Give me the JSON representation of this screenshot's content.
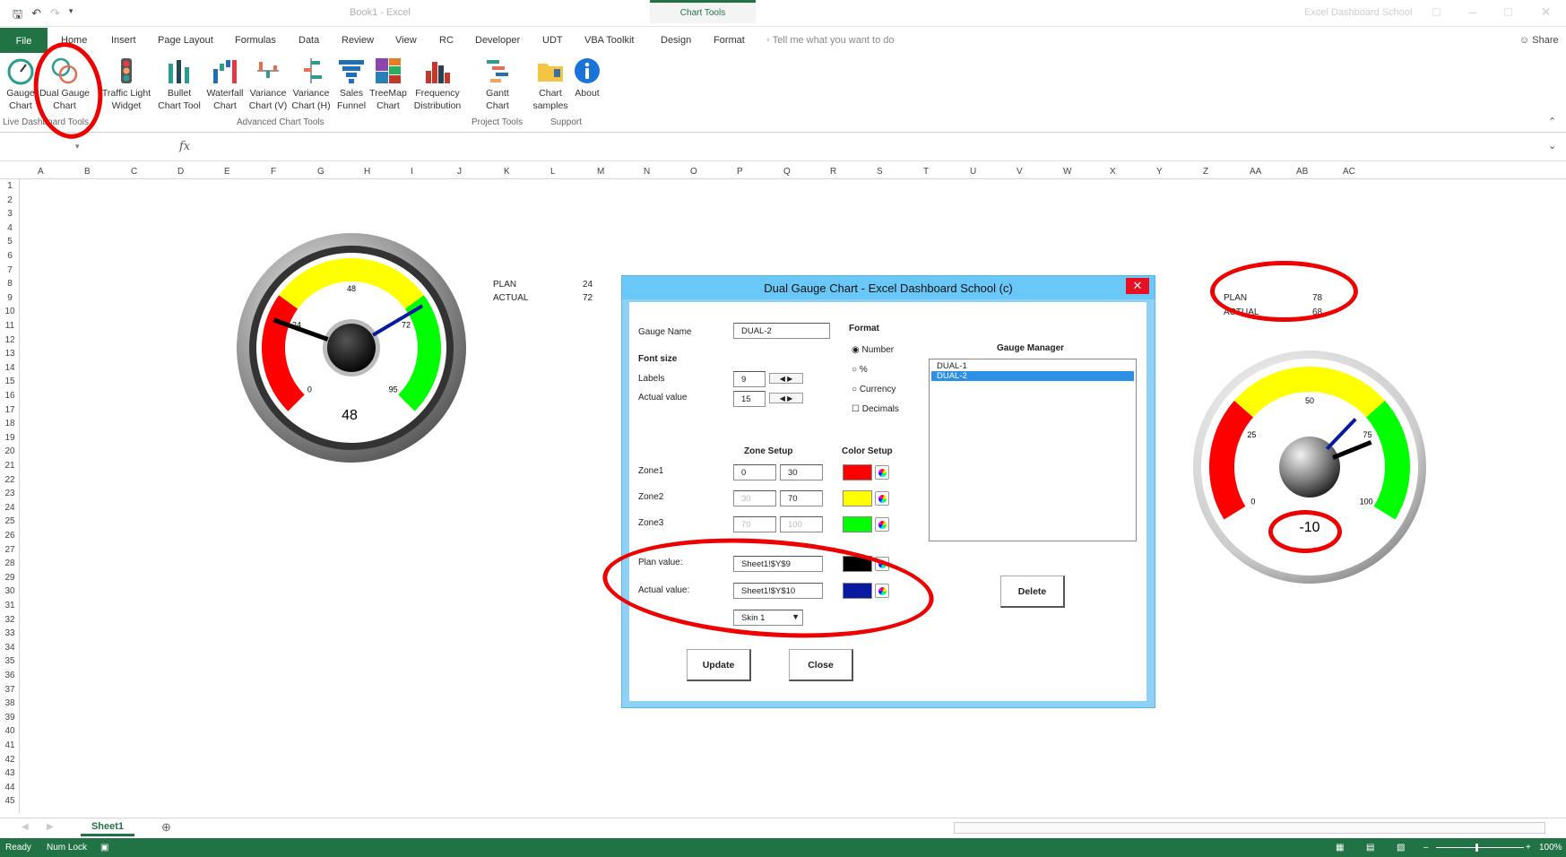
{
  "titlebar": {
    "doc_title": "Book1 - Excel",
    "chart_tools": "Chart Tools",
    "right_title": "Excel Dashboard School"
  },
  "tabs": [
    {
      "label": "File"
    },
    {
      "label": "Home"
    },
    {
      "label": "Insert"
    },
    {
      "label": "Page Layout"
    },
    {
      "label": "Formulas"
    },
    {
      "label": "Data"
    },
    {
      "label": "Review"
    },
    {
      "label": "View"
    },
    {
      "label": "RC"
    },
    {
      "label": "Developer"
    },
    {
      "label": "UDT"
    },
    {
      "label": "VBA Toolkit"
    },
    {
      "label": "Design"
    },
    {
      "label": "Format"
    }
  ],
  "tellme": "Tell me what you want to do",
  "share": "Share",
  "ribbon": {
    "buttons": [
      {
        "l1": "Gauge",
        "l2": "Chart"
      },
      {
        "l1": "Dual Gauge",
        "l2": "Chart"
      },
      {
        "l1": "Traffic Light",
        "l2": "Widget"
      },
      {
        "l1": "Bullet",
        "l2": "Chart Tool"
      },
      {
        "l1": "Waterfall",
        "l2": "Chart"
      },
      {
        "l1": "Variance",
        "l2": "Chart (V)"
      },
      {
        "l1": "Variance",
        "l2": "Chart (H)"
      },
      {
        "l1": "Sales",
        "l2": "Funnel"
      },
      {
        "l1": "TreeMap",
        "l2": "Chart"
      },
      {
        "l1": "Frequency",
        "l2": "Distribution"
      },
      {
        "l1": "Gantt",
        "l2": "Chart"
      },
      {
        "l1": "Chart",
        "l2": "samples"
      },
      {
        "l1": "About",
        "l2": ""
      }
    ],
    "groups": [
      "Live Dashboard Tools",
      "Advanced Chart Tools",
      "Project Tools",
      "Support"
    ]
  },
  "formula_fx": "fx",
  "columns": [
    "A",
    "B",
    "C",
    "D",
    "E",
    "F",
    "G",
    "H",
    "I",
    "J",
    "K",
    "L",
    "M",
    "N",
    "O",
    "P",
    "Q",
    "R",
    "S",
    "T",
    "U",
    "V",
    "W",
    "X",
    "Y",
    "Z",
    "AA",
    "AB",
    "AC"
  ],
  "rows": [
    "1",
    "2",
    "3",
    "4",
    "5",
    "6",
    "7",
    "8",
    "9",
    "10",
    "11",
    "12",
    "13",
    "14",
    "15",
    "16",
    "17",
    "18",
    "19",
    "20",
    "21",
    "22",
    "23",
    "24",
    "25",
    "26",
    "27",
    "28",
    "29",
    "30",
    "31",
    "32",
    "33",
    "34",
    "35",
    "36",
    "37",
    "38",
    "39",
    "40",
    "41",
    "42",
    "43",
    "44",
    "45"
  ],
  "cells": {
    "left": {
      "plan_label": "PLAN",
      "plan_value": "24",
      "actual_label": "ACTUAL",
      "actual_value": "72"
    },
    "right": {
      "plan_label": "PLAN",
      "plan_value": "78",
      "actual_label": "ACTUAL",
      "actual_value": "68"
    }
  },
  "gauge_left": {
    "labels": [
      "0",
      "24",
      "48",
      "72",
      "95"
    ],
    "display": "48",
    "plan": 24,
    "actual": 72
  },
  "gauge_right": {
    "labels": [
      "0",
      "25",
      "50",
      "75",
      "100"
    ],
    "display": "-10",
    "plan": 78,
    "actual": 68
  },
  "dialog": {
    "title": "Dual Gauge Chart - Excel Dashboard School (c)",
    "close": "✕",
    "gauge_name_label": "Gauge Name",
    "gauge_name_value": "DUAL-2",
    "font_size": "Font size",
    "labels_label": "Labels",
    "labels_value": "9",
    "actual_value_label": "Actual value",
    "actual_value_value": "15",
    "format_header": "Format",
    "format_options": [
      "Number",
      "%",
      "Currency"
    ],
    "decimals": "Decimals",
    "gauge_manager": "Gauge Manager",
    "manager_items": [
      "DUAL-1",
      "DUAL-2"
    ],
    "zone_setup": "Zone Setup",
    "color_setup": "Color Setup",
    "zones": [
      {
        "label": "Zone1",
        "from": "0",
        "to": "30",
        "color": "#ff0000"
      },
      {
        "label": "Zone2",
        "from": "30",
        "to": "70",
        "color": "#ffff00"
      },
      {
        "label": "Zone3",
        "from": "70",
        "to": "100",
        "color": "#00ff00"
      }
    ],
    "plan_value_label": "Plan value:",
    "plan_value_ref": "Sheet1!$Y$9",
    "plan_color": "#000000",
    "actual_value_label2": "Actual value:",
    "actual_value_ref": "Sheet1!$Y$10",
    "actual_color": "#0a1aa0",
    "skin": "Skin 1",
    "update": "Update",
    "close_btn": "Close",
    "delete": "Delete"
  },
  "sheet_tab": "Sheet1",
  "status": {
    "ready": "Ready",
    "numlock": "Num Lock",
    "zoom": "100%"
  },
  "colors": {
    "excel_green": "#217346",
    "dialog_blue": "#8fd0f5",
    "annotation_red": "#e00000"
  }
}
